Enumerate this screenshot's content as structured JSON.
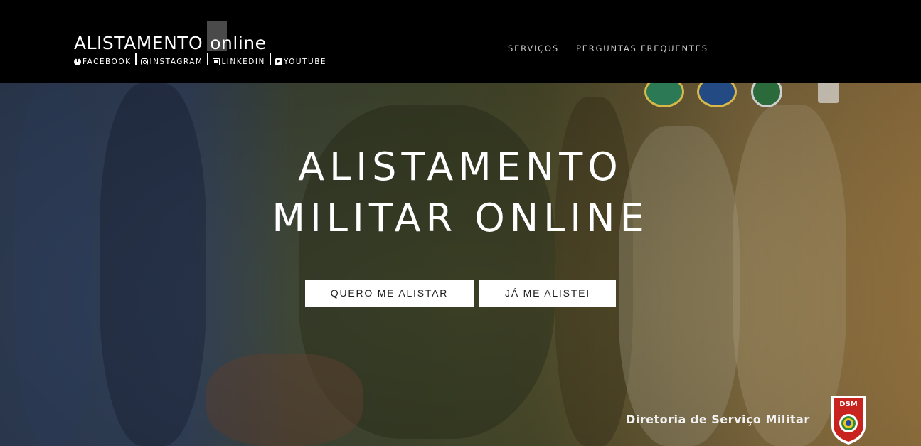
{
  "header": {
    "brand_main": "ALISTAMENTO",
    "brand_sub": "online",
    "social": [
      {
        "icon": "facebook-icon",
        "label": "FACEBOOK"
      },
      {
        "icon": "instagram-icon",
        "label": "INSTAGRAM"
      },
      {
        "icon": "linkedin-icon",
        "label": "LINKEDIN"
      },
      {
        "icon": "youtube-icon",
        "label": "YOUTUBE"
      }
    ],
    "nav": [
      "SERVIÇOS",
      "PERGUNTAS FREQUENTES"
    ]
  },
  "hero": {
    "title_line1": "ALISTAMENTO",
    "title_line2": "MILITAR ONLINE",
    "buttons": [
      "QUERO ME ALISTAR",
      "JÁ ME ALISTEI"
    ],
    "footer_text": "Diretoria de Serviço Militar",
    "badge_text": "DSM"
  },
  "colors": {
    "header_bg": "#000000",
    "button_bg": "#ffffff",
    "button_text": "#1e1e1e"
  }
}
